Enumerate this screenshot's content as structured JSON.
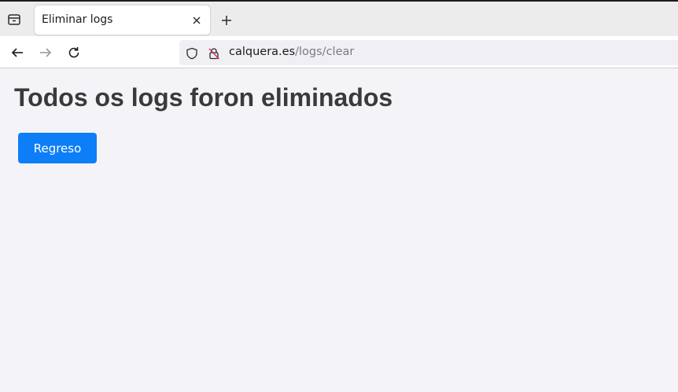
{
  "browser": {
    "tab": {
      "title": "Eliminar logs",
      "close_icon": "close-icon"
    },
    "new_tab_icon": "plus-icon",
    "tab_list_icon": "tab-list-icon",
    "nav": {
      "back_icon": "arrow-left-icon",
      "forward_icon": "arrow-right-icon",
      "reload_icon": "reload-icon"
    },
    "url": {
      "host": "calquera.es",
      "path": "/logs/clear",
      "shield_icon": "shield-icon",
      "insecure_lock_icon": "insecure-lock-icon"
    }
  },
  "page": {
    "heading": "Todos os logs foron eliminados",
    "back_button_label": "Regreso"
  },
  "colors": {
    "page_background": "#f4f3f8",
    "button_background": "#0d7ef8",
    "heading_text": "#3a3a3a"
  }
}
